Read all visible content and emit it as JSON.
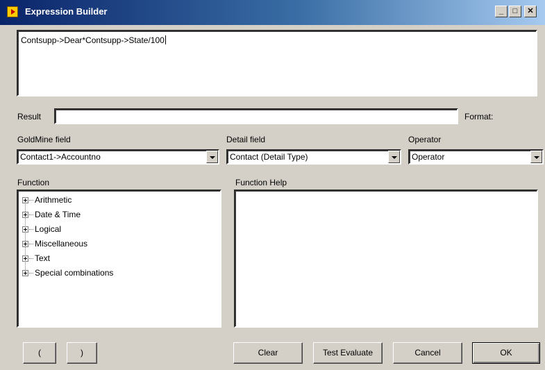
{
  "window": {
    "title": "Expression Builder",
    "controls": {
      "minimize": "_",
      "maximize": "□",
      "close": "✕"
    }
  },
  "expression": {
    "value": "Contsupp->Dear*Contsupp->State/100"
  },
  "result": {
    "label": "Result",
    "value": "",
    "format_label": "Format:"
  },
  "goldmine_field": {
    "label": "GoldMine field",
    "selected": "Contact1->Accountno"
  },
  "detail_field": {
    "label": "Detail field",
    "selected": "Contact (Detail Type)"
  },
  "operator": {
    "label": "Operator",
    "selected": "Operator"
  },
  "function": {
    "label": "Function",
    "items": [
      {
        "label": "Arithmetic"
      },
      {
        "label": "Date & Time"
      },
      {
        "label": "Logical"
      },
      {
        "label": "Miscellaneous"
      },
      {
        "label": "Text"
      },
      {
        "label": "Special combinations"
      }
    ]
  },
  "function_help": {
    "label": "Function Help",
    "text": ""
  },
  "buttons": {
    "open_paren": "(",
    "close_paren": ")",
    "clear": "Clear",
    "test_evaluate": "Test Evaluate",
    "cancel": "Cancel",
    "ok": "OK"
  },
  "icons": {
    "app": "app-icon",
    "expand": "plus-box-icon",
    "dropdown": "chevron-down-icon"
  }
}
